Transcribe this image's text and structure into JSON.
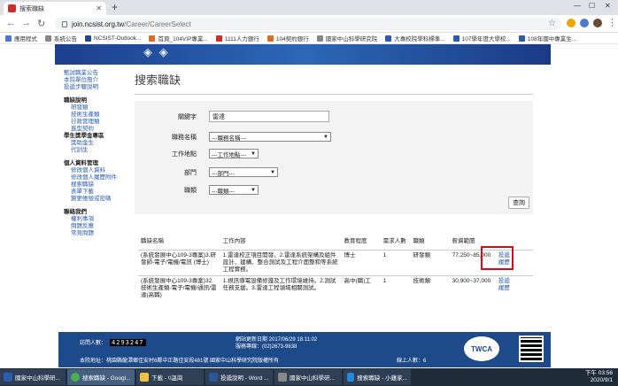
{
  "browser": {
    "tab_title": "搜索職缺",
    "new_tab": "+",
    "url_host": "join.ncsist.org.tw",
    "url_path": "/Career/CareerSelect",
    "bookmarks": [
      "應用程式",
      "系統公告",
      "NCSIST-Outlook...",
      "首頁_104VIP專業...",
      "1111人力銀行",
      "104契約銀行",
      "國家中山科學研究院",
      "大專校院學科標準...",
      "107學年度大學校...",
      "108年國中專業生..."
    ]
  },
  "sidebar": {
    "top_links": [
      "甄試職業公告",
      "本院單位簡介",
      "投遞步驟說明"
    ],
    "job_head": "職缺說明",
    "job_items": [
      "研發類",
      "技術生產類",
      "行政管理類",
      "進型契約"
    ],
    "student_head": "學生獎學金專區",
    "student_items": [
      "獎助金生",
      "代訓生"
    ],
    "personal_head": "個人資料管理",
    "personal_items": [
      "修改個人資料",
      "修改個人履歷附件",
      "搜索職缺",
      "表單下載",
      "變更帳號或密碼"
    ],
    "contact_head": "聯絡我們",
    "contact_items": [
      "權利事項",
      "問題反應",
      "常見問題"
    ]
  },
  "main": {
    "title": "搜索職缺",
    "form": {
      "keyword_label": "關鍵字",
      "keyword_value": "雷達",
      "job_label": "職務名稱",
      "job_value": "---職務名稱---",
      "location_label": "工作地點",
      "location_value": "---工作地點---",
      "dept_label": "部門",
      "dept_value": "---部門---",
      "type_label": "職類",
      "type_value": "---職類---",
      "query_label": "查詢"
    },
    "table": {
      "headers": [
        "職缺名稱",
        "工作內容",
        "教育程度",
        "需求人數",
        "職類",
        "薪資範圍",
        ""
      ],
      "rows": [
        {
          "name": "(系統發展中心109-3專案)3.研發師-電子/電機/電訊 (博士)",
          "content": "1.雷達校正項目開發。2.雷達系統架構及組件設計、建構、整合測試及工程介面整和等系統工程實務。",
          "edu": "博士",
          "count": "1",
          "type": "研發類",
          "salary": "77,250~85,000",
          "action1": "投遞",
          "action2": "履歷"
        },
        {
          "name": "(系統發展中心109-3專案)32.技術生產類-電子/電機/通訊/雷達(高職)",
          "content": "1.視訊導電設備修護及工作環境維持。2.測試任務支援。3.雷達工程領域相關測試。",
          "edu": "高中(職)工",
          "count": "1",
          "type": "技術類",
          "salary": "30,900~37,000",
          "action1": "投遞",
          "action2": "履歷"
        }
      ]
    }
  },
  "footer": {
    "visitor_label": "訪問人數：",
    "visitor_count": "4293247",
    "update_line": "網站更新日期 2017/06/29 18:11:02",
    "phone_line": "服務專線：(02)2673-9638",
    "copyright_line": "國家中山科學研究院版權所有",
    "address_line": "本院地址：桃園縣龍潭鄉佳安村6鄰中正路佳安段481號 國家中山科學研究院版權所有",
    "online_line": "線上人數：6",
    "twca": "TWCA"
  },
  "taskbar": {
    "items": [
      "國家中山科學研...",
      "搜索職缺 - Googl...",
      "下載 - \\\\溫崗",
      "投遞說明 - Word ...",
      "國家中山科學研...",
      "搜索職缺 - 小雞家..."
    ],
    "time": "下午 03:56",
    "date": "2020/9/1"
  }
}
